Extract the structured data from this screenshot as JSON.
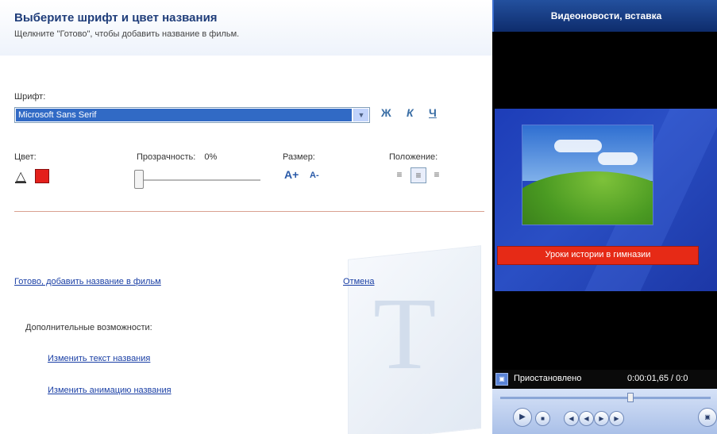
{
  "header": {
    "title": "Выберите шрифт и цвет названия",
    "subtitle": "Щелкните \"Готово\", чтобы добавить название в фильм."
  },
  "font": {
    "label": "Шрифт:",
    "selected": "Microsoft Sans Serif",
    "bold_label": "Ж",
    "italic_label": "К",
    "underline_label": "Ч"
  },
  "color": {
    "label": "Цвет:",
    "swatch": "#e4201b"
  },
  "transparency": {
    "label": "Прозрачность:",
    "value_text": "0%",
    "value": 0
  },
  "size": {
    "label": "Размер:",
    "increase_label": "A+",
    "decrease_label": "A-"
  },
  "position": {
    "label": "Положение:",
    "selected": "center"
  },
  "links": {
    "done": "Готово, добавить название в фильм",
    "cancel": "Отмена"
  },
  "more_options": {
    "label": "Дополнительные возможности:",
    "items": [
      "Изменить текст названия",
      "Изменить анимацию названия"
    ]
  },
  "preview": {
    "title": "Видеоновости, вставка",
    "caption": "Уроки истории в гимназии",
    "status": "Приостановлено",
    "time": "0:00:01,65 / 0:0"
  },
  "colors": {
    "accent_blue": "#316ac5",
    "caption_red": "#e62a16",
    "preview_bg": "#1d3db8"
  }
}
